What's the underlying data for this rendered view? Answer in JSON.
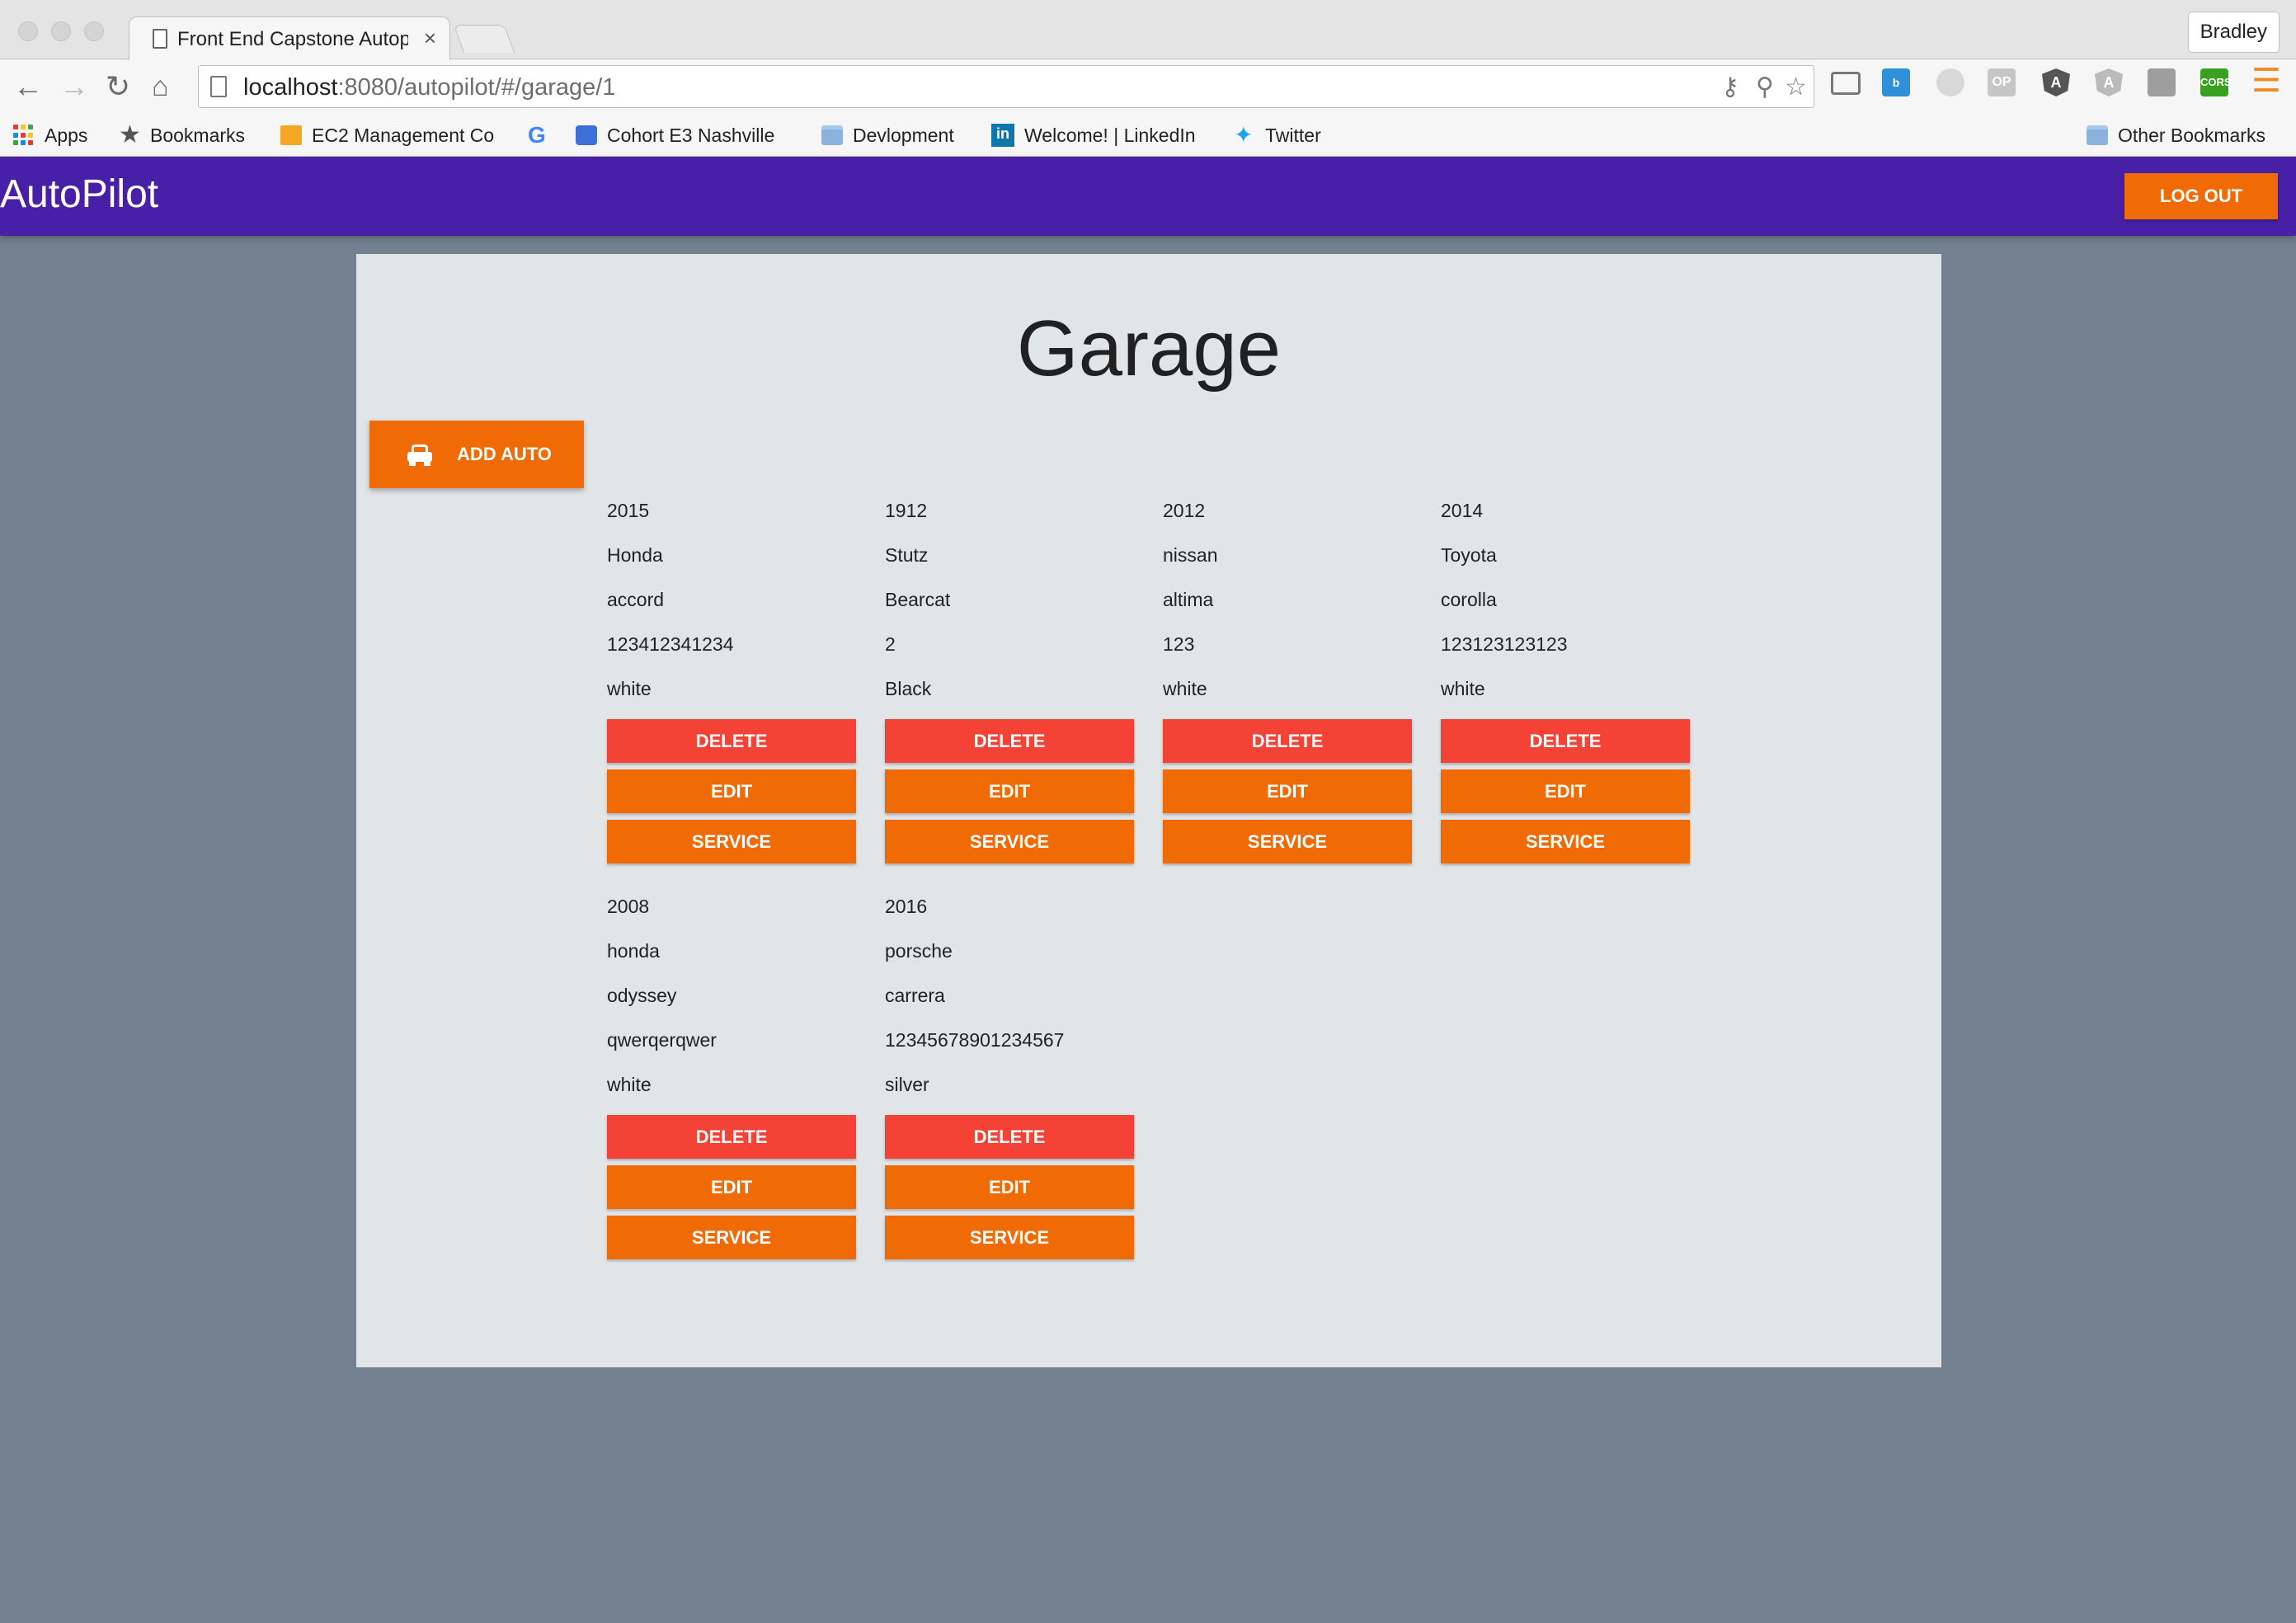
{
  "browser": {
    "tab_title": "Front End Capstone Autopi",
    "tab_close": "×",
    "profile_name": "Bradley",
    "url_host": "localhost",
    "url_path": ":8080/autopilot/#/garage/1",
    "bookmarks": [
      {
        "label": "Apps",
        "icon": "apps-grid-icon"
      },
      {
        "label": "Bookmarks",
        "icon": "star-icon"
      },
      {
        "label": "EC2 Management Co",
        "icon": "aws-box-icon"
      },
      {
        "label": "",
        "icon": "google-icon"
      },
      {
        "label": "Cohort E3 Nashville",
        "icon": "chat-icon"
      },
      {
        "label": "Devlopment",
        "icon": "folder-icon"
      },
      {
        "label": "Welcome! | LinkedIn",
        "icon": "linkedin-icon"
      },
      {
        "label": "Twitter",
        "icon": "twitter-icon"
      }
    ],
    "other_bookmarks": "Other Bookmarks"
  },
  "app": {
    "brand": "AutoPilot",
    "logout_label": "LOG OUT",
    "accent_color": "#f06b06",
    "header_color": "#4820a8",
    "delete_color": "#f44336"
  },
  "garage": {
    "title": "Garage",
    "add_label": "ADD AUTO",
    "button_labels": {
      "delete": "DELETE",
      "edit": "EDIT",
      "service": "SERVICE"
    },
    "cars": [
      {
        "year": "2015",
        "make": "Honda",
        "model": "accord",
        "vin": "123412341234",
        "color": "white"
      },
      {
        "year": "1912",
        "make": "Stutz",
        "model": "Bearcat",
        "vin": "2",
        "color": "Black"
      },
      {
        "year": "2012",
        "make": "nissan",
        "model": "altima",
        "vin": "123",
        "color": "white"
      },
      {
        "year": "2014",
        "make": "Toyota",
        "model": "corolla",
        "vin": "123123123123",
        "color": "white"
      },
      {
        "year": "2008",
        "make": "honda",
        "model": "odyssey",
        "vin": "qwerqerqwer",
        "color": "white"
      },
      {
        "year": "2016",
        "make": "porsche",
        "model": "carrera",
        "vin": "12345678901234567",
        "color": "silver"
      }
    ]
  }
}
